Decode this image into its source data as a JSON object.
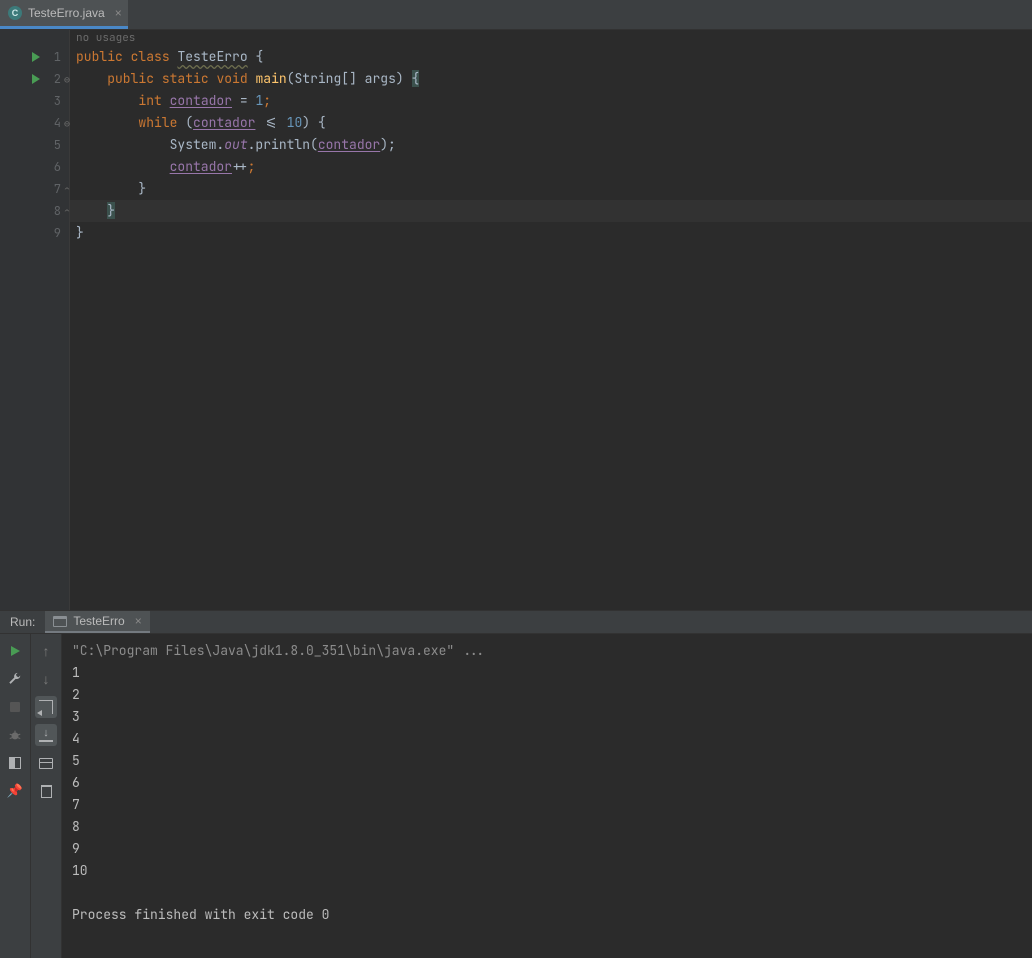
{
  "tabs": {
    "file": {
      "name": "TesteErro.java",
      "iconLetter": "C"
    }
  },
  "editor": {
    "usagesHint": "no usages",
    "lineNumbers": [
      "1",
      "2",
      "3",
      "4",
      "5",
      "6",
      "7",
      "8",
      "9"
    ],
    "code": {
      "l1": {
        "kw1": "public",
        "kw2": "class",
        "cls": "TesteErro",
        "brace": "{"
      },
      "l2": {
        "kw1": "public",
        "kw2": "static",
        "kw3": "void",
        "fn": "main",
        "args": "(String[] args)",
        "brace": "{"
      },
      "l3": {
        "kw": "int",
        "var": "contador",
        "assign": " = ",
        "num": "1",
        "semi": ";"
      },
      "l4": {
        "kw": "while",
        "open": "(",
        "var": "contador",
        "op": " <= ",
        "num": "10",
        "close": ")",
        "brace": " {"
      },
      "l5": {
        "sys": "System.",
        "out": "out",
        "call": ".println(",
        "var": "contador",
        "close": ");"
      },
      "l6": {
        "var": "contador",
        "op": "++",
        "semi": ";"
      },
      "l7": {
        "t": "}"
      },
      "l8": {
        "t": "}"
      },
      "l9": {
        "t": "}"
      }
    }
  },
  "runWindow": {
    "label": "Run:",
    "configName": "TesteErro",
    "cmd": "\"C:\\Program Files\\Java\\jdk1.8.0_351\\bin\\java.exe\" ...",
    "output": [
      "1",
      "2",
      "3",
      "4",
      "5",
      "6",
      "7",
      "8",
      "9",
      "10"
    ],
    "blank": "",
    "exit": "Process finished with exit code 0"
  }
}
